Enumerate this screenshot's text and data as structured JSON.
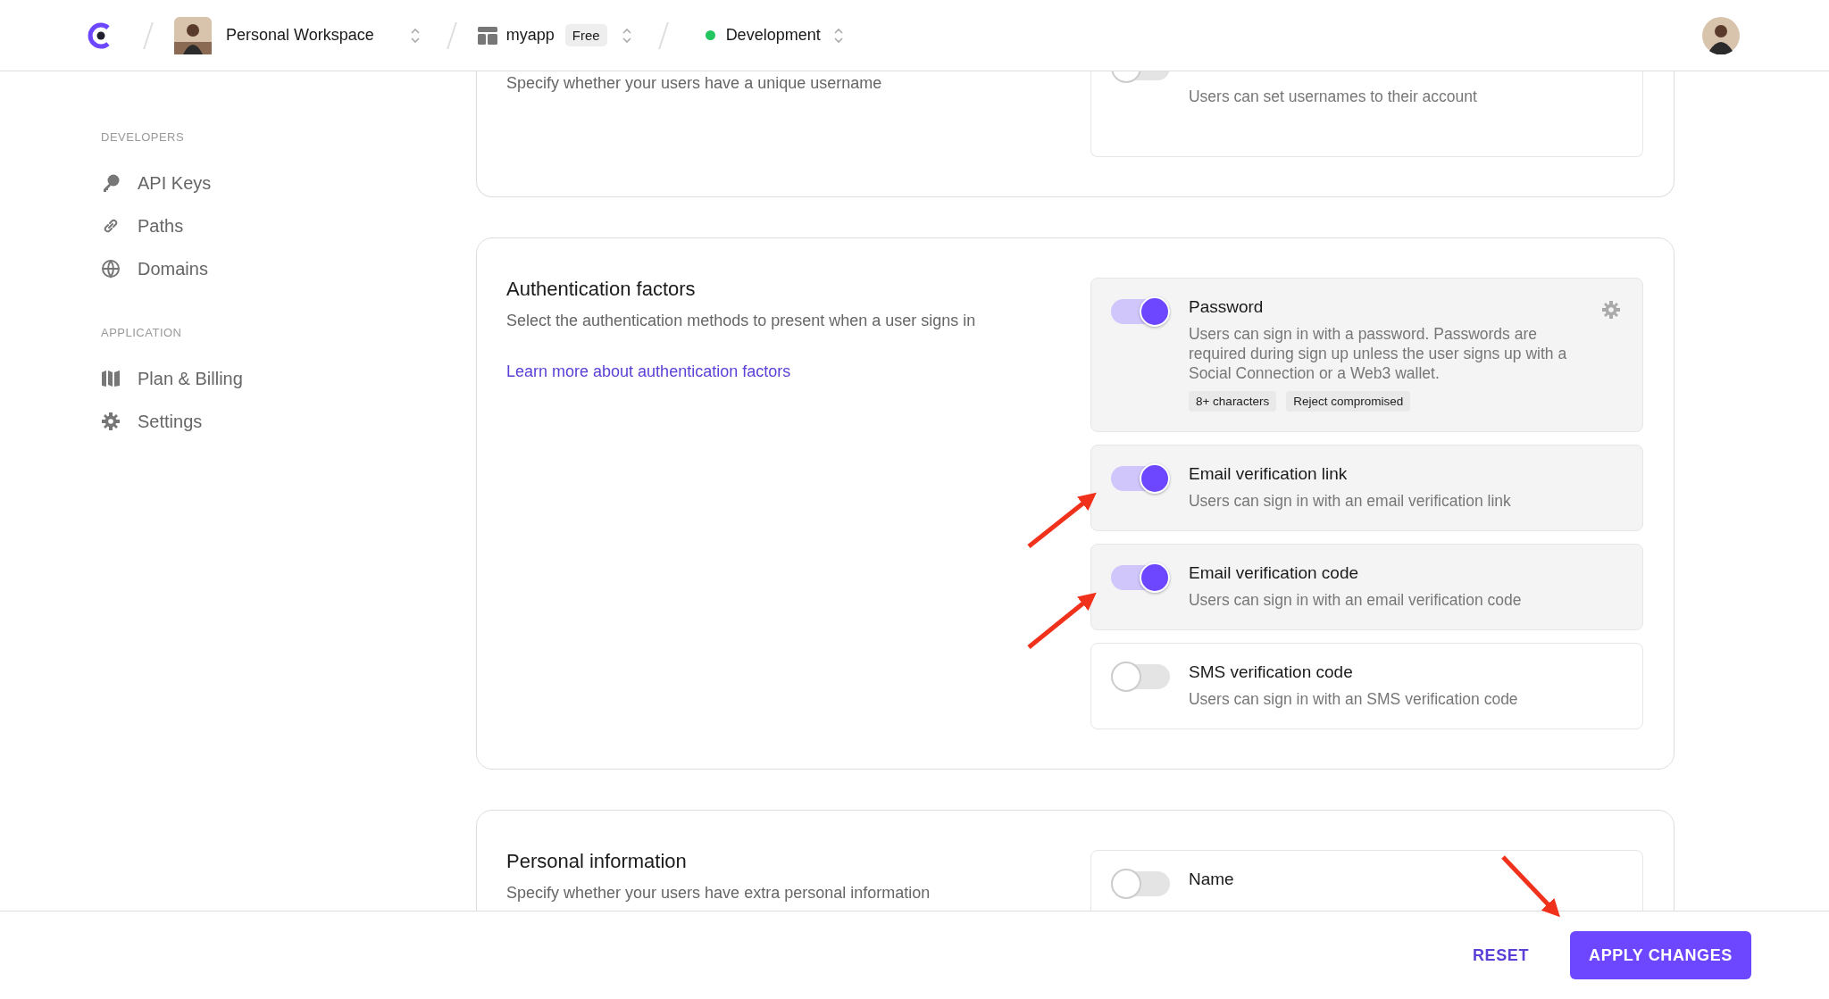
{
  "topbar": {
    "workspace": "Personal Workspace",
    "app": {
      "name": "myapp",
      "plan": "Free"
    },
    "environment": {
      "name": "Development",
      "color": "#22c55e"
    }
  },
  "sidebar": {
    "sections": [
      {
        "heading": "DEVELOPERS",
        "items": [
          {
            "label": "API Keys",
            "kind": "key"
          },
          {
            "label": "Paths",
            "kind": "link"
          },
          {
            "label": "Domains",
            "kind": "globe"
          }
        ]
      },
      {
        "heading": "APPLICATION",
        "items": [
          {
            "label": "Plan & Billing",
            "kind": "map"
          },
          {
            "label": "Settings",
            "kind": "gear"
          }
        ]
      }
    ]
  },
  "sections": [
    {
      "description": "Specify whether your users have a unique username",
      "options": [
        {
          "description": "Users can set usernames to their account",
          "on": false
        }
      ]
    },
    {
      "title": "Authentication factors",
      "description": "Select the authentication methods to present when a user signs in",
      "link": "Learn more about authentication factors",
      "options": [
        {
          "title": "Password",
          "description": "Users can sign in with a password. Passwords are required during sign up unless the user signs up with a Social Connection or a Web3 wallet.",
          "on": true,
          "settings": true,
          "tags": [
            "8+ characters",
            "Reject compromised"
          ]
        },
        {
          "title": "Email verification link",
          "description": "Users can sign in with an email verification link",
          "on": true
        },
        {
          "title": "Email verification code",
          "description": "Users can sign in with an email verification code",
          "on": true
        },
        {
          "title": "SMS verification code",
          "description": "Users can sign in with an SMS verification code",
          "on": false
        }
      ]
    },
    {
      "title": "Personal information",
      "description": "Specify whether your users have extra personal information",
      "options": [
        {
          "title": "Name",
          "on": false
        }
      ]
    }
  ],
  "footer": {
    "buttons": [
      {
        "label": "RESET",
        "kind": "text"
      },
      {
        "label": "APPLY CHANGES",
        "kind": "primary"
      }
    ]
  }
}
